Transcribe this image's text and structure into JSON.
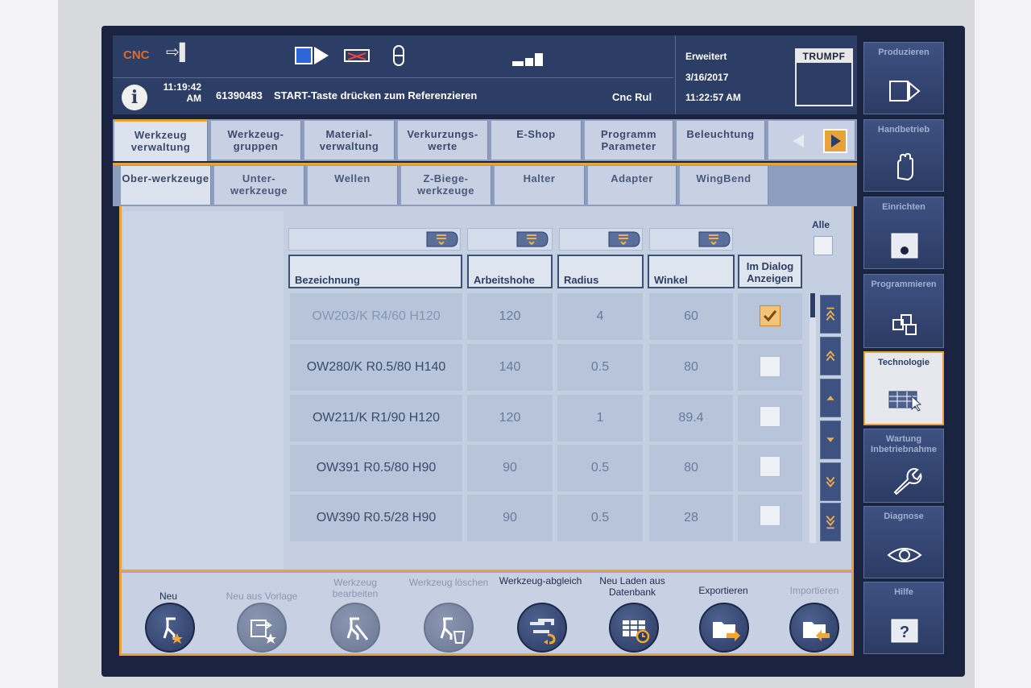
{
  "header": {
    "cnc_label": "CNC",
    "time_top": "11:19:42",
    "time_ampm": "AM",
    "message_number": "61390483",
    "message_text": "START-Taste drücken zum Referenzieren",
    "cnc_state": "Cnc Rul",
    "mode": "Erweitert",
    "date": "3/16/2017",
    "clock": "11:22:57 AM",
    "logo": "TRUMPF"
  },
  "sidebar": [
    {
      "label": "Produzieren",
      "icon": "play-frame-icon"
    },
    {
      "label": "Handbetrieb",
      "icon": "hand-icon"
    },
    {
      "label": "Einrichten",
      "icon": "setup-icon"
    },
    {
      "label": "Programmieren",
      "icon": "blocks-icon"
    },
    {
      "label": "Technologie",
      "icon": "table-cursor-icon",
      "active": true
    },
    {
      "label": "Wartung Inbetriebnahme",
      "icon": "wrench-icon"
    },
    {
      "label": "Diagnose",
      "icon": "eye-icon"
    },
    {
      "label": "Hilfe",
      "icon": "help-icon"
    }
  ],
  "tabs_primary": [
    {
      "label": "Werkzeug verwaltung",
      "selected": true
    },
    {
      "label": "Werkzeug-gruppen"
    },
    {
      "label": "Material-verwaltung"
    },
    {
      "label": "Verkurzungs-werte"
    },
    {
      "label": "E-Shop"
    },
    {
      "label": "Programm Parameter"
    },
    {
      "label": "Beleuchtung"
    }
  ],
  "tabs_secondary": [
    {
      "label": "Ober-werkzeuge",
      "selected": true
    },
    {
      "label": "Unter-werkzeuge"
    },
    {
      "label": "Wellen"
    },
    {
      "label": "Z-Biege-werkzeuge"
    },
    {
      "label": "Halter"
    },
    {
      "label": "Adapter"
    },
    {
      "label": "WingBend"
    }
  ],
  "table": {
    "select_all_label": "Alle",
    "columns": [
      "Bezeichnung",
      "Arbeitshohe",
      "Radius",
      "Winkel",
      "Im Dialog Anzeigen"
    ],
    "rows": [
      {
        "name": "OW203/K R4/60 H120",
        "height": "120",
        "radius": "4",
        "angle": "60",
        "checked": true
      },
      {
        "name": "OW280/K R0.5/80 H140",
        "height": "140",
        "radius": "0.5",
        "angle": "80",
        "checked": false
      },
      {
        "name": "OW211/K R1/90 H120",
        "height": "120",
        "radius": "1",
        "angle": "89.4",
        "checked": false
      },
      {
        "name": "OW391 R0.5/80 H90",
        "height": "90",
        "radius": "0.5",
        "angle": "80",
        "checked": false
      },
      {
        "name": "OW390 R0.5/28 H90",
        "height": "90",
        "radius": "0.5",
        "angle": "28",
        "checked": false
      }
    ]
  },
  "toolbar": [
    {
      "label": "Neu",
      "icon": "new-tool-icon",
      "enabled": true
    },
    {
      "label": "Neu aus Vorlage",
      "icon": "new-from-template-icon",
      "enabled": false
    },
    {
      "label": "Werkzeug bearbeiten",
      "icon": "edit-tool-icon",
      "enabled": false
    },
    {
      "label": "Werkzeug löschen",
      "icon": "delete-tool-icon",
      "enabled": false
    },
    {
      "label": "Werkzeug-abgleich",
      "icon": "sync-tool-icon",
      "enabled": true
    },
    {
      "label": "Neu Laden aus Datenbank",
      "icon": "reload-database-icon",
      "enabled": true
    },
    {
      "label": "Exportieren",
      "icon": "export-folder-icon",
      "enabled": true
    },
    {
      "label": "Importieren",
      "icon": "import-folder-icon",
      "enabled": true
    }
  ],
  "colors": {
    "accent": "#e8a23a",
    "panel": "#2c3d66",
    "cnc": "#e06a2b"
  }
}
